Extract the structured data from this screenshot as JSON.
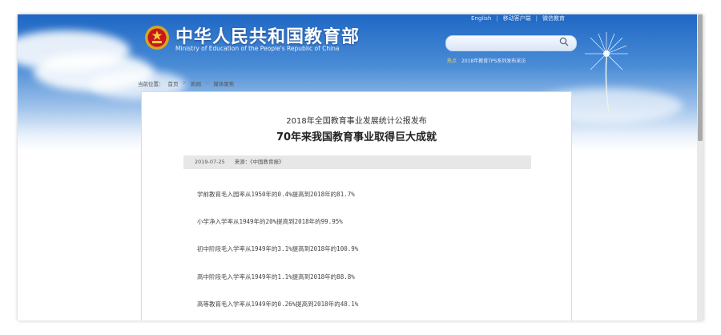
{
  "header": {
    "site_title": "中华人民共和国教育部",
    "site_subtitle": "Ministry of Education of the People's Republic of China",
    "top_links": [
      "English",
      "移动客户端",
      "微信教育"
    ],
    "news_tag": "热点",
    "news_text": "2018年教育TPS系列发布采访"
  },
  "search": {
    "placeholder": ""
  },
  "breadcrumb": {
    "prefix": "当前位置：",
    "items": [
      "首页",
      "新闻",
      "媒体聚焦"
    ]
  },
  "article": {
    "subtitle": "2018年全国教育事业发展统计公报发布",
    "title": "70年来我国教育事业取得巨大成就",
    "date": "2019-07-25",
    "source": "来源：《中国教育报》",
    "lines": [
      "学前教育毛入园率从1950年的0.4%提高到2018年的81.7%",
      "小学净入学率从1949年的20%提高到2018年的99.95%",
      "初中阶段毛入学率从1949年的3.1%提高到2018年的100.9%",
      "高中阶段毛入学率从1949年的1.1%提高到2018年的88.8%",
      "高等教育毛入学率从1949年的0.26%提高到2018年的48.1%"
    ]
  },
  "icons": {
    "emblem": "national-emblem-icon",
    "search": "search-icon",
    "decoration": "dandelion-icon"
  },
  "colors": {
    "sky_top": "#1e67c4",
    "title_text": "#ffffff",
    "news_tag": "#ffd44a",
    "meta_bar": "#e7e7e7"
  }
}
